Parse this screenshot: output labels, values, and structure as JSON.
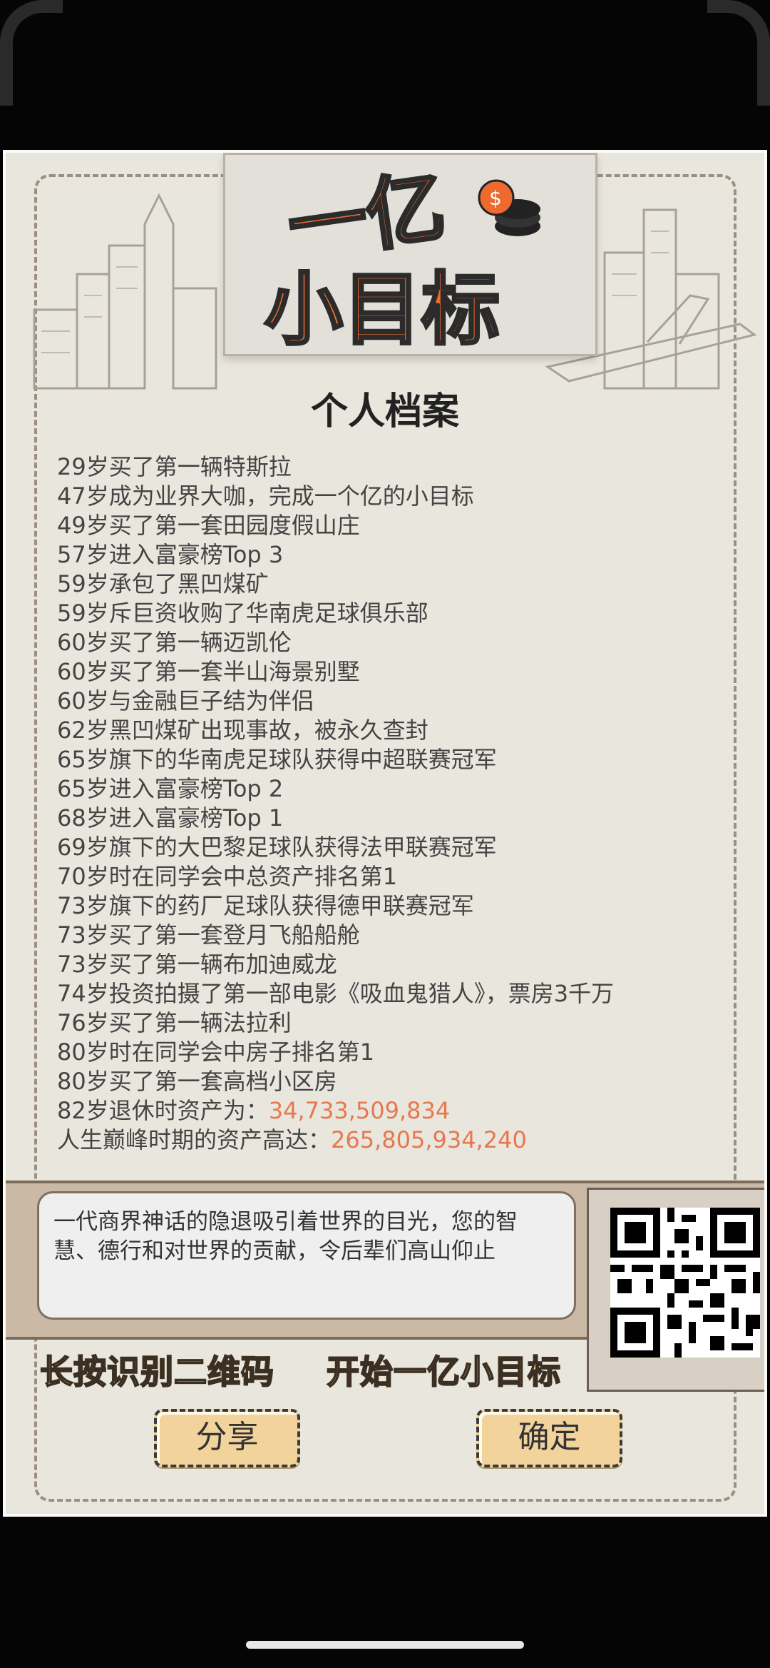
{
  "logo": {
    "line1": "一亿",
    "line2": "小目标"
  },
  "title": "个人档案",
  "events": [
    "29岁买了第一辆特斯拉",
    "47岁成为业界大咖，完成一个亿的小目标",
    "49岁买了第一套田园度假山庄",
    "57岁进入富豪榜Top 3",
    "59岁承包了黑凹煤矿",
    "59岁斥巨资收购了华南虎足球俱乐部",
    "60岁买了第一辆迈凯伦",
    "60岁买了第一套半山海景别墅",
    "60岁与金融巨子结为伴侣",
    "62岁黑凹煤矿出现事故，被永久查封",
    "65岁旗下的华南虎足球队获得中超联赛冠军",
    "65岁进入富豪榜Top 2",
    "68岁进入富豪榜Top 1",
    "69岁旗下的大巴黎足球队获得法甲联赛冠军",
    "70岁时在同学会中总资产排名第1",
    "73岁旗下的药厂足球队获得德甲联赛冠军",
    "73岁买了第一套登月飞船船舱",
    "73岁买了第一辆布加迪威龙",
    "74岁投资拍摄了第一部电影《吸血鬼猎人》，票房3千万",
    "76岁买了第一辆法拉利",
    "80岁时在同学会中房子排名第1",
    "80岁买了第一套高档小区房"
  ],
  "retire": {
    "label": "82岁退休时资产为：",
    "value": "34,733,509,834"
  },
  "peak": {
    "label": "人生巅峰时期的资产高达：",
    "value": "265,805,934,240"
  },
  "quote": "一代商界神话的隐退吸引着世界的目光，您的智慧、德行和对世界的贡献，令后辈们高山仰止",
  "slogan_left": "长按识别二维码",
  "slogan_right": "开始一亿小目标",
  "buttons": {
    "share": "分享",
    "ok": "确定"
  },
  "colors": {
    "highlight": "#e6784f",
    "background": "#e9e6dd",
    "button": "#f2d39b",
    "logo_orange": "#ee6a2e"
  },
  "icons": [
    "coin-stack-icon",
    "qr-code-icon",
    "airplane-icon",
    "city-skyline-icon"
  ]
}
